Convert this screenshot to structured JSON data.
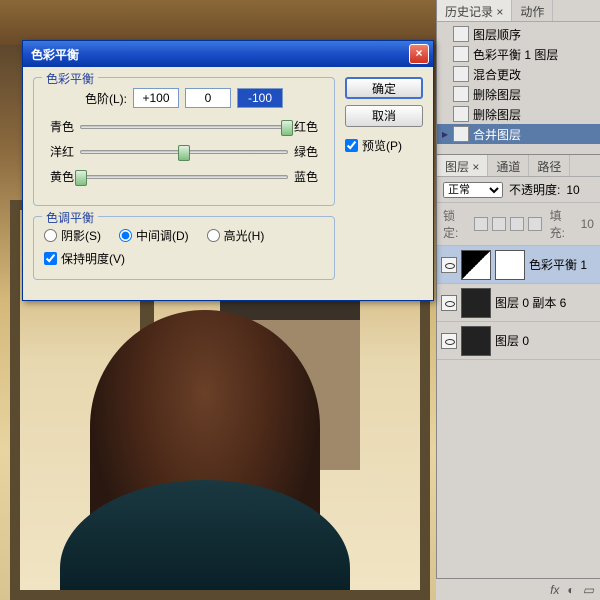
{
  "dialog": {
    "title": "色彩平衡",
    "group_color": "色彩平衡",
    "group_tone": "色调平衡",
    "levels_label": "色阶(L):",
    "level_cyan": "+100",
    "level_mag": "0",
    "level_yel": "-100",
    "pair1_l": "青色",
    "pair1_r": "红色",
    "pair2_l": "洋红",
    "pair2_r": "绿色",
    "pair3_l": "黄色",
    "pair3_r": "蓝色",
    "tone_shadow": "阴影(S)",
    "tone_mid": "中间调(D)",
    "tone_high": "高光(H)",
    "preserve": "保持明度(V)",
    "ok": "确定",
    "cancel": "取消",
    "preview": "预览(P)"
  },
  "history": {
    "tab1": "历史记录 ×",
    "tab2": "动作",
    "items": [
      {
        "label": "图层顺序"
      },
      {
        "label": "色彩平衡 1 图层"
      },
      {
        "label": "混合更改"
      },
      {
        "label": "删除图层"
      },
      {
        "label": "删除图层"
      },
      {
        "label": "合并图层"
      }
    ]
  },
  "layers": {
    "tab1": "图层 ×",
    "tab2": "通道",
    "tab3": "路径",
    "mode": "正常",
    "opacity_label": "不透明度:",
    "opacity_val": "10",
    "lock_label": "锁定:",
    "fill_label": "填充:",
    "fill_val": "10",
    "items": [
      {
        "name": "色彩平衡 1"
      },
      {
        "name": "图层 0 副本 6"
      },
      {
        "name": "图层 0"
      }
    ],
    "fx": "fx"
  }
}
